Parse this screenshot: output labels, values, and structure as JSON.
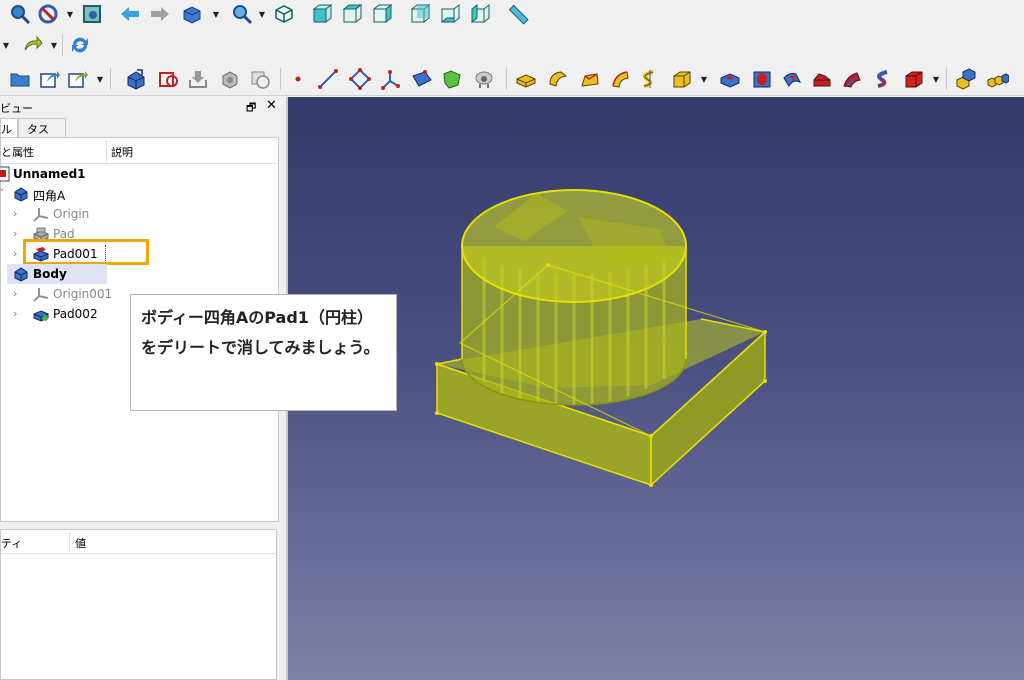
{
  "toolbar3": {
    "sketcher_icons": [
      "point-icon",
      "line-icon",
      "polygon-icon",
      "axis-icon"
    ]
  },
  "combo": {
    "title": "ビュー",
    "tabs": [
      {
        "label": "ル",
        "active": true
      },
      {
        "label": "タスク",
        "active": false
      }
    ],
    "columns": [
      "と属性",
      "説明"
    ],
    "tree": [
      {
        "label": "Unnamed1",
        "level": 0,
        "bold": true
      },
      {
        "label": "四角A",
        "level": 1
      },
      {
        "label": "Origin",
        "level": 2,
        "grey": true
      },
      {
        "label": "Pad",
        "level": 2,
        "grey": true
      },
      {
        "label": "Pad001",
        "level": 2,
        "highlighted": true
      },
      {
        "label": "Body",
        "level": 1,
        "bold": true,
        "active_body": true
      },
      {
        "label": "Origin001",
        "level": 2,
        "grey": true
      },
      {
        "label": "Pad002",
        "level": 2
      }
    ],
    "property_columns": [
      "ティ",
      "値"
    ]
  },
  "callout": {
    "text": "ボディー四角AのPad1（円柱）をデリートで消してみましょう。"
  },
  "colors": {
    "highlight_frame": "#f3a500",
    "selection_fill": "#c8d414",
    "selection_edge": "#e8e000",
    "view_top": "#333a6a",
    "view_bottom": "#7f80a3"
  }
}
